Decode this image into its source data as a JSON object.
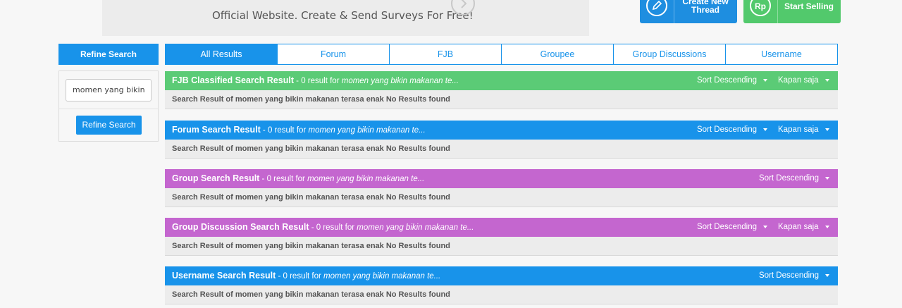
{
  "banner": {
    "text": "Official Website. Create & Send Surveys For Free!",
    "next_icon": "chevron-right-icon"
  },
  "actions": {
    "create_thread": {
      "label_line1": "Create New",
      "label_line2": "Thread",
      "icon": "pencil-icon",
      "color": "#1e8ee0"
    },
    "start_selling": {
      "label": "Start Selling",
      "icon": "rupiah-icon",
      "color": "#52c96c"
    }
  },
  "refine": {
    "header": "Refine Search",
    "query": "momen yang bikin",
    "button": "Refine Search"
  },
  "tabs": [
    "All Results",
    "Forum",
    "FJB",
    "Groupee",
    "Group Discussions",
    "Username"
  ],
  "sections": [
    {
      "title": "FJB Classified Search Result",
      "summary": " - 0 result for ",
      "query": "momen yang bikin makanan te...",
      "sort": "Sort Descending",
      "time": "Kapan saja",
      "body": "Search Result of momen yang bikin makanan terasa enak No Results found",
      "color": "#5bcb76"
    },
    {
      "title": "Forum Search Result",
      "summary": " - 0 result for ",
      "query": "momen yang bikin makanan te...",
      "sort": "Sort Descending",
      "time": "Kapan saja",
      "body": "Search Result of momen yang bikin makanan terasa enak No Results found",
      "color": "#1893ea"
    },
    {
      "title": "Group Search Result",
      "summary": " - 0 result for ",
      "query": "momen yang bikin makanan te...",
      "sort": "Sort Descending",
      "body": "Search Result of momen yang bikin makanan terasa enak No Results found",
      "color": "#c466cf"
    },
    {
      "title": "Group Discussion Search Result",
      "summary": " - 0 result for ",
      "query": "momen yang bikin makanan te...",
      "sort": "Sort Descending",
      "time": "Kapan saja",
      "body": "Search Result of momen yang bikin makanan terasa enak No Results found",
      "color": "#c466cf"
    },
    {
      "title": "Username Search Result",
      "summary": " - 0 result for ",
      "query": "momen yang bikin makanan te...",
      "sort": "Sort Descending",
      "body": "Search Result of momen yang bikin makanan terasa enak No Results found",
      "color": "#1893ea"
    }
  ]
}
